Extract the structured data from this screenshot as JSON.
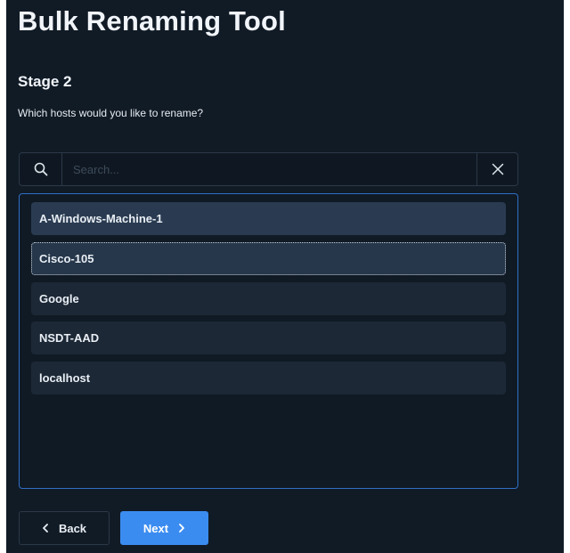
{
  "header": {
    "title": "Bulk Renaming Tool"
  },
  "stage": {
    "heading": "Stage 2",
    "question": "Which hosts would you like to rename?"
  },
  "search": {
    "placeholder": "Search...",
    "value": "",
    "icon": "search-icon",
    "clear_icon": "close-icon"
  },
  "hosts": {
    "items": [
      {
        "label": "A-Windows-Machine-1",
        "state": "selected"
      },
      {
        "label": "Cisco-105",
        "state": "focused"
      },
      {
        "label": "Google",
        "state": "normal"
      },
      {
        "label": "NSDT-AAD",
        "state": "normal"
      },
      {
        "label": "localhost",
        "state": "normal"
      }
    ]
  },
  "nav": {
    "back_label": "Back",
    "back_icon": "chevron-left-icon",
    "next_label": "Next",
    "next_icon": "chevron-right-icon"
  },
  "colors": {
    "background": "#111b26",
    "accent": "#3b8cf0",
    "list_border": "#2f6fc4",
    "item_background": "#1c2836",
    "item_selected": "#2a3b51"
  }
}
